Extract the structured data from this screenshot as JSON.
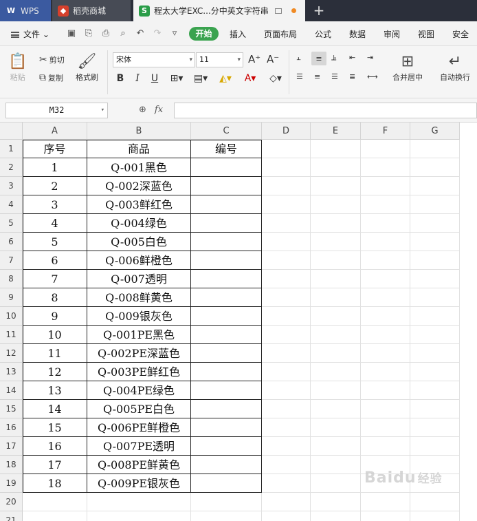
{
  "tabs": {
    "wps": "WPS",
    "store": "稻壳商城",
    "doc": "程太大学EXC...分中英文字符串"
  },
  "menu": {
    "file": "文件",
    "start": "开始",
    "items": [
      "插入",
      "页面布局",
      "公式",
      "数据",
      "审阅",
      "视图",
      "安全"
    ]
  },
  "ribbon": {
    "paste": "粘贴",
    "cut": "剪切",
    "copy": "复制",
    "format_painter": "格式刷",
    "font_name": "宋体",
    "font_size": "11",
    "merge_center": "合并居中",
    "wrap_text": "自动换行"
  },
  "formula_bar": {
    "name_box": "M32",
    "formula": ""
  },
  "sheet": {
    "columns": [
      "A",
      "B",
      "C",
      "D",
      "E",
      "F",
      "G"
    ],
    "row_numbers": [
      "1",
      "2",
      "3",
      "4",
      "5",
      "6",
      "7",
      "8",
      "9",
      "10",
      "11",
      "12",
      "13",
      "14",
      "15",
      "16",
      "17",
      "18",
      "19",
      "20",
      "21"
    ],
    "header": [
      "序号",
      "商品",
      "编号"
    ],
    "rows": [
      [
        "1",
        "Q-001黑色",
        ""
      ],
      [
        "2",
        "Q-002深蓝色",
        ""
      ],
      [
        "3",
        "Q-003鲜红色",
        ""
      ],
      [
        "4",
        "Q-004绿色",
        ""
      ],
      [
        "5",
        "Q-005白色",
        ""
      ],
      [
        "6",
        "Q-006鲜橙色",
        ""
      ],
      [
        "7",
        "Q-007透明",
        ""
      ],
      [
        "8",
        "Q-008鲜黄色",
        ""
      ],
      [
        "9",
        "Q-009银灰色",
        ""
      ],
      [
        "10",
        "Q-001PE黑色",
        ""
      ],
      [
        "11",
        "Q-002PE深蓝色",
        ""
      ],
      [
        "12",
        "Q-003PE鲜红色",
        ""
      ],
      [
        "13",
        "Q-004PE绿色",
        ""
      ],
      [
        "14",
        "Q-005PE白色",
        ""
      ],
      [
        "15",
        "Q-006PE鲜橙色",
        ""
      ],
      [
        "16",
        "Q-007PE透明",
        ""
      ],
      [
        "17",
        "Q-008PE鲜黄色",
        ""
      ],
      [
        "18",
        "Q-009PE银灰色",
        ""
      ]
    ]
  },
  "watermark": {
    "brand": "Baidu",
    "suffix": "经验"
  },
  "colors": {
    "title_bar": "#2b2f3a",
    "wps_tab": "#3b5aa0",
    "start_button": "#3aa34f",
    "unsaved_dot": "#f08a24"
  }
}
